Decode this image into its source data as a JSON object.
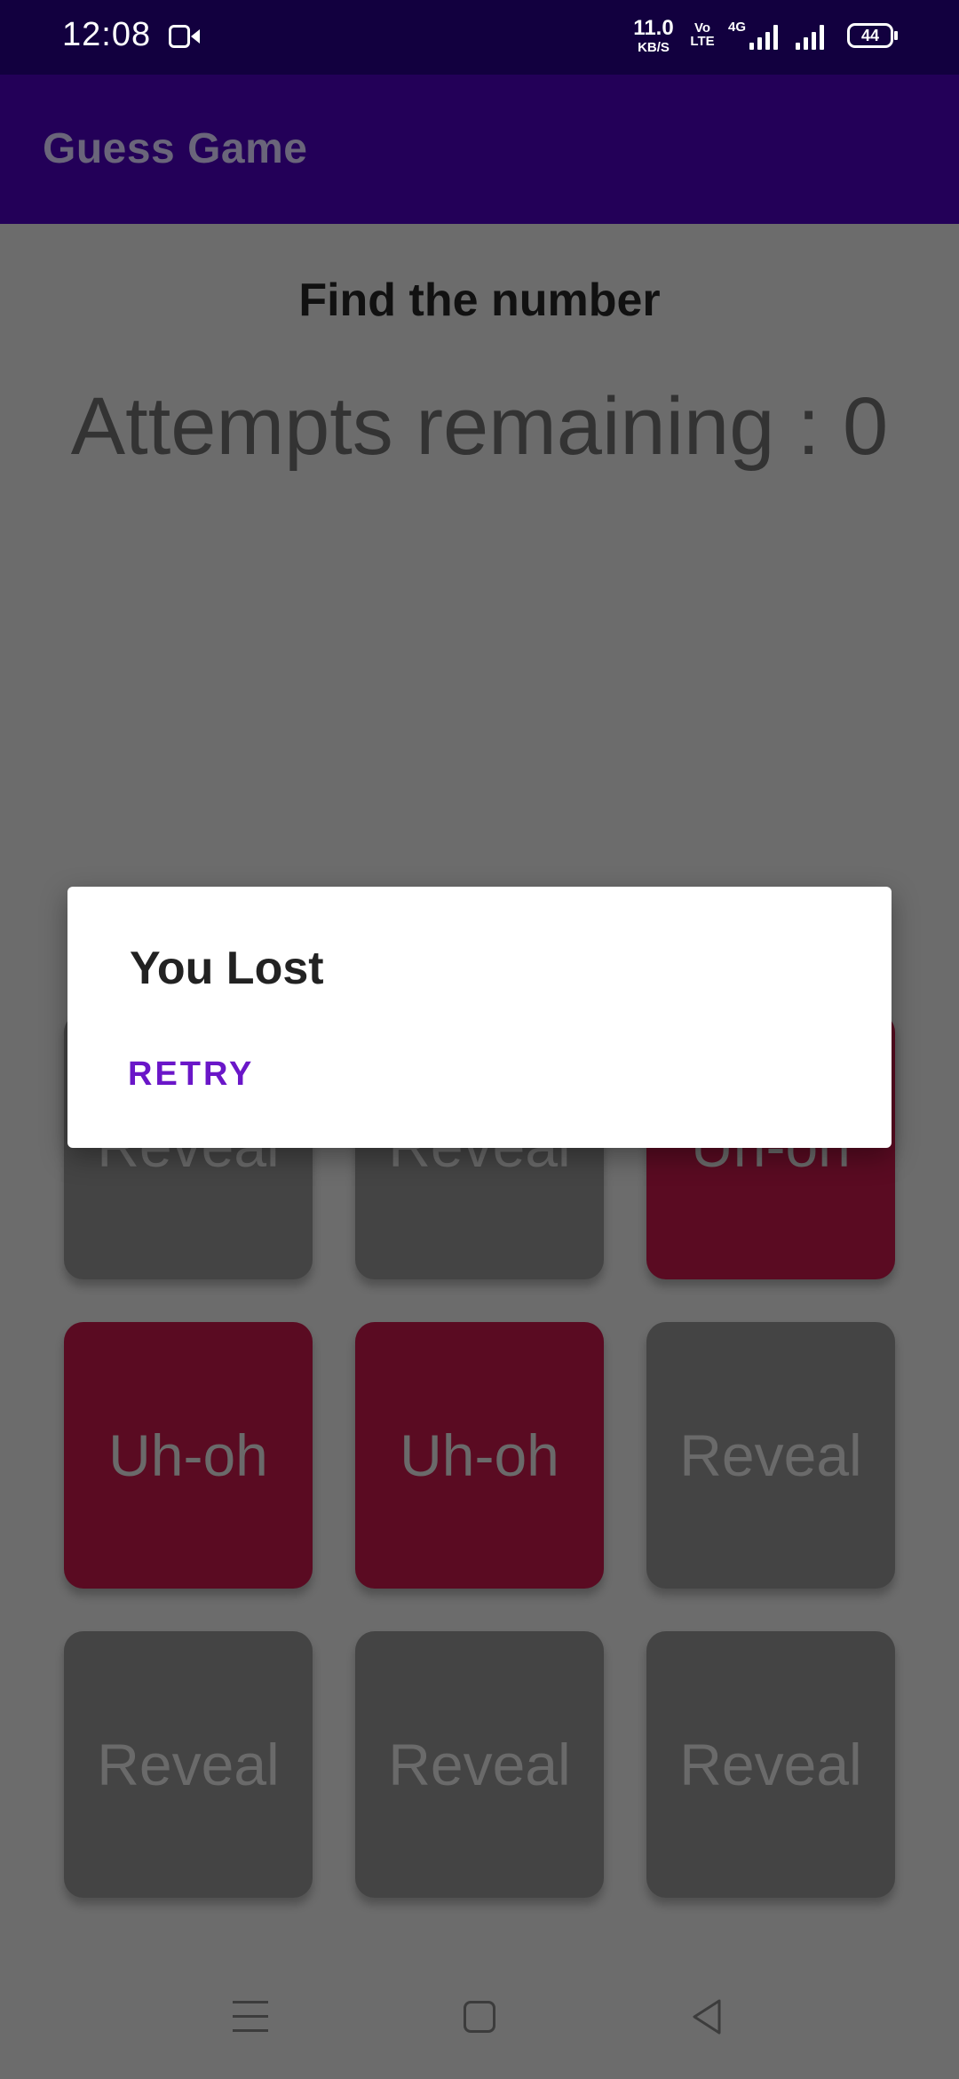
{
  "status_bar": {
    "time": "12:08",
    "net_speed_value": "11.0",
    "net_speed_unit": "KB/S",
    "volte_label": "Vo LTE",
    "network_type": "4G",
    "battery": "44",
    "icons": [
      "camera-icon",
      "volte-icon",
      "signal-icon",
      "battery-icon"
    ]
  },
  "app_bar": {
    "title": "Guess Game",
    "color": "#230058"
  },
  "main": {
    "heading": "Find the number",
    "attempts_text": "Attempts remaining : 0",
    "tiles": [
      {
        "label": "Reveal",
        "state": "hidden"
      },
      {
        "label": "Reveal",
        "state": "hidden"
      },
      {
        "label": "Uh-oh",
        "state": "wrong"
      },
      {
        "label": "Uh-oh",
        "state": "wrong"
      },
      {
        "label": "Uh-oh",
        "state": "wrong"
      },
      {
        "label": "Reveal",
        "state": "hidden"
      },
      {
        "label": "Reveal",
        "state": "hidden"
      },
      {
        "label": "Reveal",
        "state": "hidden"
      },
      {
        "label": "Reveal",
        "state": "hidden"
      }
    ]
  },
  "dialog": {
    "title": "You Lost",
    "button_label": "RETRY",
    "accent_color": "#6a16c8"
  },
  "nav_bar": {
    "icons": [
      "menu-icon",
      "home-icon",
      "back-icon"
    ]
  }
}
